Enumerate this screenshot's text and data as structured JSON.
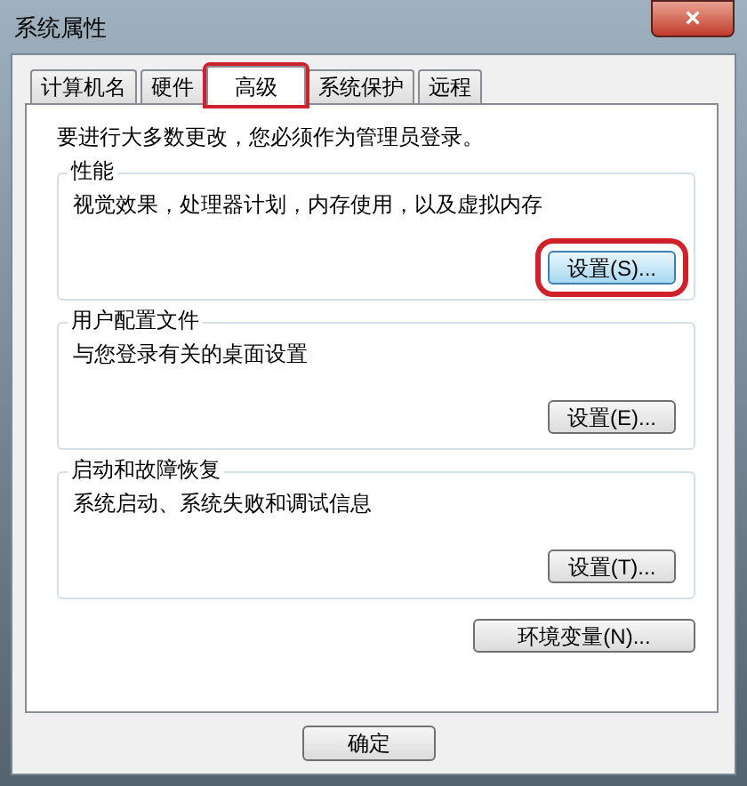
{
  "window": {
    "title": "系统属性",
    "close": "×"
  },
  "tabs": [
    {
      "label": "计算机名",
      "selected": false,
      "highlighted": false
    },
    {
      "label": "硬件",
      "selected": false,
      "highlighted": false
    },
    {
      "label": "高级",
      "selected": true,
      "highlighted": true
    },
    {
      "label": "系统保护",
      "selected": false,
      "highlighted": false
    },
    {
      "label": "远程",
      "selected": false,
      "highlighted": false
    }
  ],
  "notice": "要进行大多数更改，您必须作为管理员登录。",
  "groups": [
    {
      "title": "性能",
      "description": "视觉效果，处理器计划，内存使用，以及虚拟内存",
      "button": "设置(S)...",
      "highlighted": true
    },
    {
      "title": "用户配置文件",
      "description": "与您登录有关的桌面设置",
      "button": "设置(E)...",
      "highlighted": false
    },
    {
      "title": "启动和故障恢复",
      "description": "系统启动、系统失败和调试信息",
      "button": "设置(T)...",
      "highlighted": false
    }
  ],
  "environment_button": "环境变量(N)...",
  "footer_buttons": [
    "确定"
  ]
}
